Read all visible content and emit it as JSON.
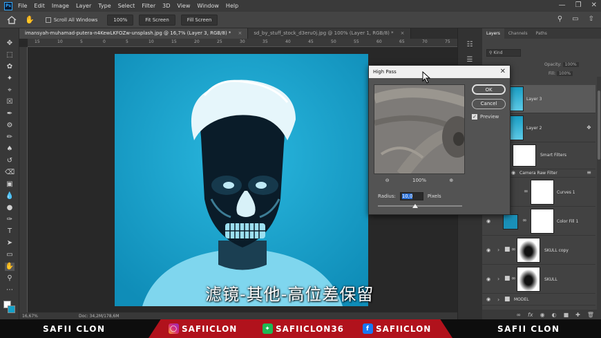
{
  "app": {
    "logo": "Ps",
    "menu": [
      "File",
      "Edit",
      "Image",
      "Layer",
      "Type",
      "Select",
      "Filter",
      "3D",
      "View",
      "Window",
      "Help"
    ]
  },
  "options": {
    "scroll_all_windows": "Scroll All Windows",
    "zoom_value": "100%",
    "fit_screen": "Fit Screen",
    "fill_screen": "Fill Screen"
  },
  "tabs": [
    {
      "label": "imansyah-muhamad-putera-n4KewLKFOZw-unsplash.jpg @ 16,7% (Layer 3, RGB/8) *",
      "active": true
    },
    {
      "label": "sd_by_stuff_stock_d3eru0j.jpg @ 100% (Layer 1, RGB/8) *",
      "active": false
    }
  ],
  "ruler_ticks": [
    "15",
    "10",
    "5",
    "0",
    "5",
    "10",
    "15",
    "20",
    "25",
    "30",
    "35",
    "40",
    "45",
    "50",
    "55",
    "60",
    "65",
    "70",
    "75"
  ],
  "status": {
    "zoom": "16,67%",
    "doc": "Doc: 34,2M/178,6M"
  },
  "layers_panel": {
    "tabs": [
      "Layers",
      "Channels",
      "Paths"
    ],
    "kind_label": "Kind",
    "opacity_label": "Opacity:",
    "opacity_value": "100%",
    "fill_label": "Fill:",
    "fill_value": "100%",
    "layers": [
      {
        "name": "Layer 3",
        "selected": true
      },
      {
        "name": "Layer 2",
        "selected": false
      },
      {
        "name": "Smart Filters",
        "selected": false
      },
      {
        "name": "Camera Raw Filter",
        "selected": false
      },
      {
        "name": "Curves 1",
        "selected": false
      },
      {
        "name": "Color Fill 1",
        "selected": false
      },
      {
        "name": "SKULL copy",
        "selected": false
      },
      {
        "name": "SKULL",
        "selected": false
      },
      {
        "name": "MODEL",
        "selected": false
      }
    ]
  },
  "dialog": {
    "title": "High Pass",
    "ok": "OK",
    "cancel": "Cancel",
    "preview_label": "Preview",
    "zoom": "100%",
    "radius_label": "Radius:",
    "radius_value": "10,0",
    "radius_unit": "Pixels",
    "radius_slider_level": 0.44
  },
  "subtitle": "滤镜-其他-高位差保留",
  "banner": {
    "brand_left": "SAFII CLON",
    "instagram": "SAFIICLON",
    "tiktok": "SAFIICLON36",
    "facebook": "SAFIICLON",
    "brand_right": "SAFII CLON"
  },
  "colors": {
    "accent_blue": "#31a8ff",
    "banner_red": "#b1121c",
    "photo_cyan": "#2fb6dc"
  }
}
